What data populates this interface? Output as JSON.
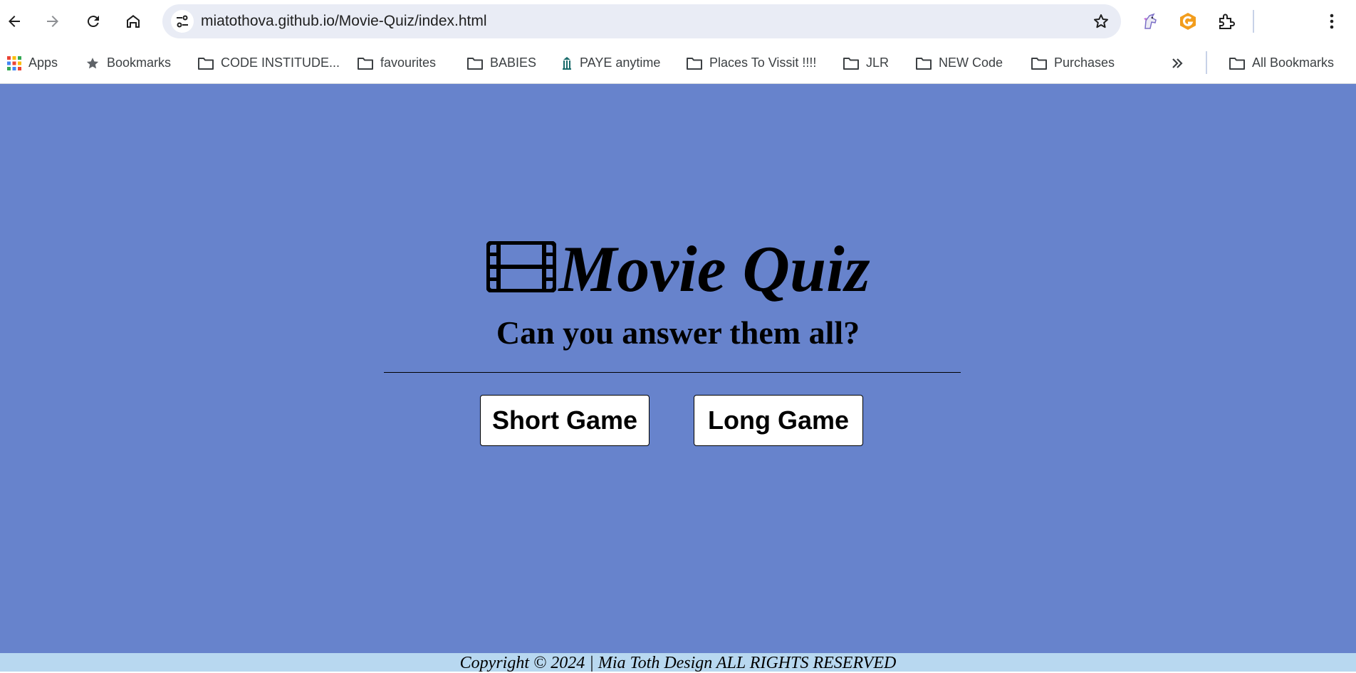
{
  "browser": {
    "url": "miatothova.github.io/Movie-Quiz/index.html"
  },
  "bookmarks_bar": {
    "items": [
      {
        "label": "Apps",
        "icon": "apps-grid-icon"
      },
      {
        "label": "Bookmarks",
        "icon": "star-icon"
      },
      {
        "label": "CODE INSTITUDE...",
        "icon": "folder-icon"
      },
      {
        "label": "favourites",
        "icon": "folder-icon"
      },
      {
        "label": "BABIES",
        "icon": "folder-icon"
      },
      {
        "label": "PAYE anytime",
        "icon": "site-icon"
      },
      {
        "label": "Places To Vissit !!!!",
        "icon": "folder-icon"
      },
      {
        "label": "JLR",
        "icon": "folder-icon"
      },
      {
        "label": "NEW Code",
        "icon": "folder-icon"
      },
      {
        "label": "Purchases",
        "icon": "folder-icon"
      }
    ],
    "all_bookmarks": "All Bookmarks"
  },
  "page": {
    "background": "#6783cc",
    "title": "Movie Quiz",
    "title_icon": "film-icon",
    "subtitle": "Can you answer them all?",
    "buttons": {
      "short": "Short Game",
      "long": "Long Game"
    },
    "footer": "Copyright © 2024 | Mia Toth Design ALL RIGHTS RESERVED",
    "footer_background": "#b8d8f0"
  }
}
